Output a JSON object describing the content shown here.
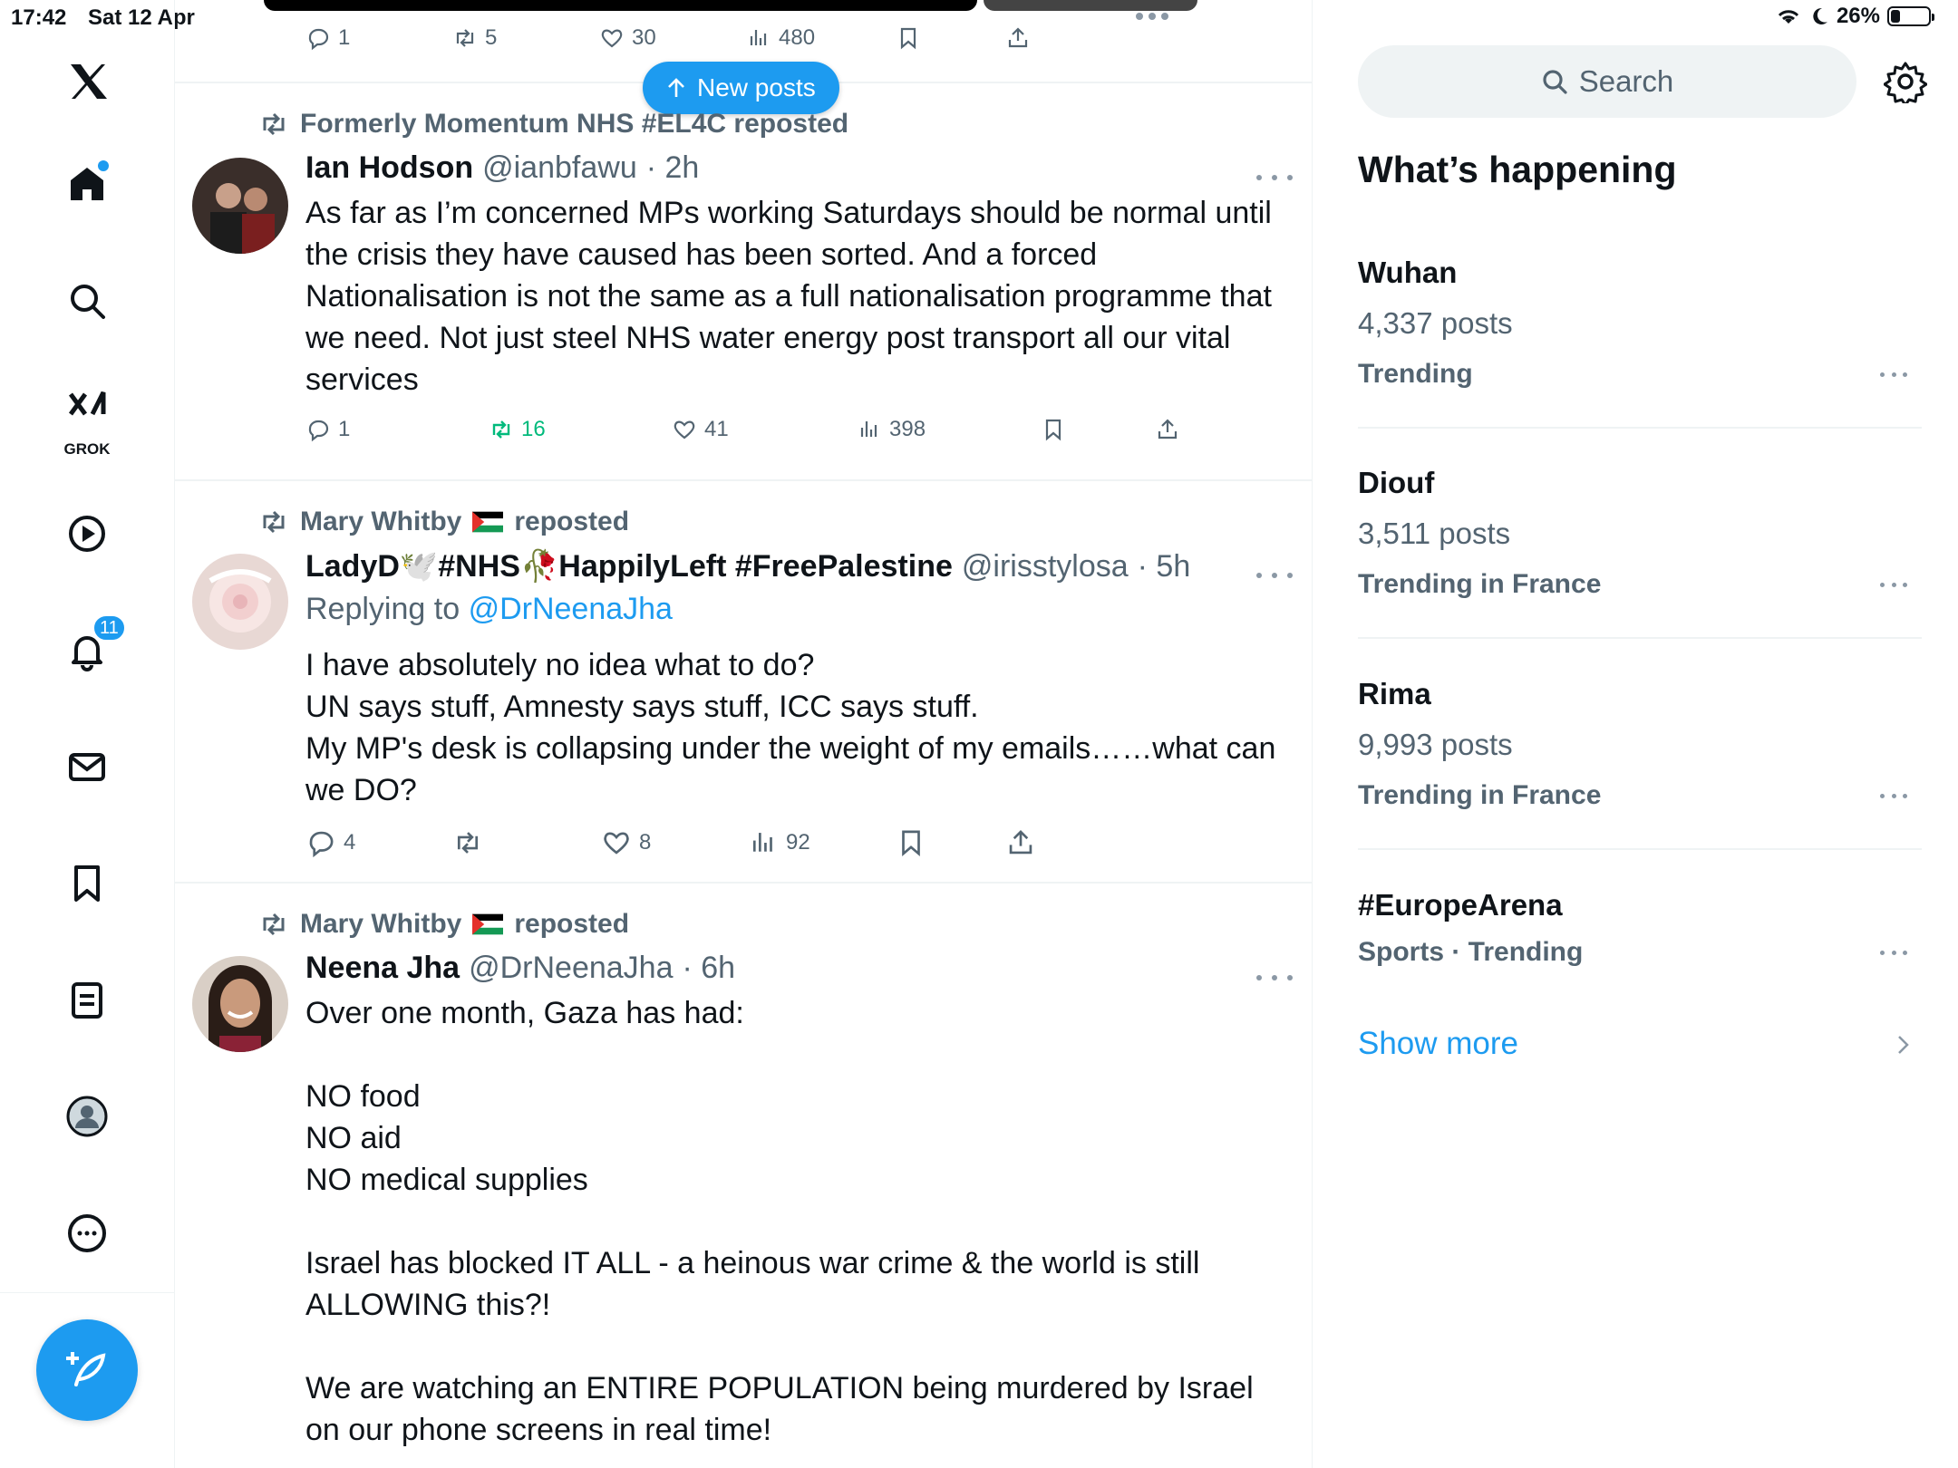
{
  "status_bar": {
    "time": "17:42",
    "date": "Sat 12 Apr",
    "battery": "26%",
    "battery_level": 0.26
  },
  "nav": {
    "notifications_badge": "11",
    "grok_label": "GROK"
  },
  "feed": {
    "top_actions": {
      "replies": "1",
      "reposts": "5",
      "likes": "30",
      "views": "480"
    },
    "new_posts_label": "New posts",
    "posts": [
      {
        "repost_by": "Formerly Momentum NHS #EL4C reposted",
        "name": "Ian Hodson",
        "handle": "@ianbfawu",
        "time": "· 2h",
        "text": "As far as I’m concerned MPs working Saturdays should be normal until the crisis they have caused has been sorted. And a forced Nationalisation is not the same as a full nationalisation programme that we need. Not just steel NHS water energy post transport all our vital services",
        "replies": "1",
        "reposts": "16",
        "likes": "41",
        "views": "398"
      },
      {
        "repost_by": "Mary Whitby",
        "repost_suffix": "reposted",
        "name": "LadyD🕊️#NHS🥀HappilyLeft #FreePalestine",
        "handle": "@irisstylosa",
        "time": "· 5h",
        "replying_prefix": "Replying to",
        "replying_to": "@DrNeenaJha",
        "text": "I have absolutely no idea what to do?\nUN says stuff, Amnesty says stuff, ICC says stuff.\nMy MP's desk is collapsing under the weight of my emails……what can we DO?",
        "replies": "4",
        "reposts": "",
        "likes": "8",
        "views": "92"
      },
      {
        "repost_by": "Mary Whitby",
        "repost_suffix": "reposted",
        "name": "Neena Jha",
        "handle": "@DrNeenaJha",
        "time": "· 6h",
        "text": "Over one month, Gaza has had:\n\nNO food\nNO aid\nNO medical supplies\n\nIsrael has blocked IT ALL - a heinous war crime & the world is still ALLOWING this?!\n\nWe are watching an ENTIRE POPULATION being murdered by Israel on our phone screens in real time!"
      }
    ]
  },
  "sidebar": {
    "search_placeholder": "Search",
    "title": "What’s happening",
    "trends": [
      {
        "name": "Wuhan",
        "count": "4,337 posts",
        "context": "Trending"
      },
      {
        "name": "Diouf",
        "count": "3,511 posts",
        "context": "Trending in France"
      },
      {
        "name": "Rima",
        "count": "9,993 posts",
        "context": "Trending in France"
      },
      {
        "name": "#EuropeArena",
        "count": "",
        "context": "Sports · Trending"
      }
    ],
    "show_more": "Show more"
  },
  "colors": {
    "accent": "#1d9bf0",
    "repost_green": "#00ba7c",
    "muted": "#536471"
  },
  "icons": [
    "x-logo-icon",
    "home-icon",
    "search-icon",
    "grok-icon",
    "video-icon",
    "bell-icon",
    "mail-icon",
    "bookmark-icon",
    "lists-icon",
    "profile-icon",
    "more-icon",
    "compose-icon",
    "reply-icon",
    "repost-icon",
    "like-icon",
    "views-icon",
    "share-icon",
    "gear-icon",
    "chevron-right-icon",
    "arrow-up-icon",
    "palestine-flag-icon"
  ]
}
